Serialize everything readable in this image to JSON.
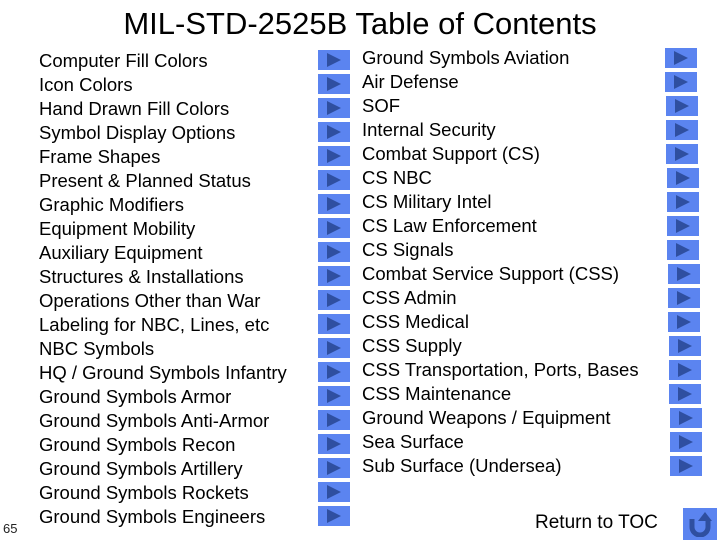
{
  "title": "MIL-STD-2525B Table of Contents",
  "page_number": "65",
  "colors": {
    "button_fill": "#5b84f0",
    "button_glyph": "#2f4fa0"
  },
  "left_items": [
    {
      "label": "Computer Fill Colors",
      "icon": "play-arrow-icon"
    },
    {
      "label": "Icon Colors",
      "icon": "play-arrow-icon"
    },
    {
      "label": "Hand Drawn Fill Colors",
      "icon": "play-arrow-icon"
    },
    {
      "label": "Symbol Display Options",
      "icon": "play-arrow-icon"
    },
    {
      "label": "Frame Shapes",
      "icon": "play-arrow-icon"
    },
    {
      "label": "Present & Planned Status",
      "icon": "play-arrow-icon"
    },
    {
      "label": "Graphic Modifiers",
      "icon": "play-arrow-icon"
    },
    {
      "label": "Equipment Mobility",
      "icon": "play-arrow-icon"
    },
    {
      "label": "Auxiliary Equipment",
      "icon": "play-arrow-icon"
    },
    {
      "label": "Structures & Installations",
      "icon": "play-arrow-icon"
    },
    {
      "label": "Operations Other than War",
      "icon": "play-arrow-icon"
    },
    {
      "label": "Labeling for NBC, Lines, etc",
      "icon": "play-arrow-icon"
    },
    {
      "label": "NBC Symbols",
      "icon": "play-arrow-icon"
    },
    {
      "label": "HQ / Ground Symbols Infantry",
      "icon": "play-arrow-icon"
    },
    {
      "label": "Ground Symbols Armor",
      "icon": "play-arrow-icon"
    },
    {
      "label": "Ground Symbols Anti-Armor",
      "icon": "play-arrow-icon"
    },
    {
      "label": "Ground Symbols Recon",
      "icon": "play-arrow-icon"
    },
    {
      "label": "Ground Symbols Artillery",
      "icon": "play-arrow-icon"
    },
    {
      "label": "Ground Symbols Rockets",
      "icon": "play-arrow-icon"
    },
    {
      "label": "Ground Symbols Engineers",
      "icon": "play-arrow-icon"
    }
  ],
  "right_items": [
    {
      "label": "Ground Symbols Aviation",
      "icon": "play-arrow-icon"
    },
    {
      "label": "Air Defense",
      "icon": "play-arrow-icon"
    },
    {
      "label": "SOF",
      "icon": "play-arrow-icon"
    },
    {
      "label": "Internal Security",
      "icon": "play-arrow-icon"
    },
    {
      "label": "Combat Support (CS)",
      "icon": "play-arrow-icon"
    },
    {
      "label": "CS NBC",
      "icon": "play-arrow-icon"
    },
    {
      "label": "CS Military Intel",
      "icon": "play-arrow-icon"
    },
    {
      "label": "CS Law Enforcement",
      "icon": "play-arrow-icon"
    },
    {
      "label": "CS Signals",
      "icon": "play-arrow-icon"
    },
    {
      "label": "Combat Service Support (CSS)",
      "icon": "play-arrow-icon"
    },
    {
      "label": "CSS Admin",
      "icon": "play-arrow-icon"
    },
    {
      "label": "CSS Medical",
      "icon": "play-arrow-icon"
    },
    {
      "label": "CSS Supply",
      "icon": "play-arrow-icon"
    },
    {
      "label": "CSS Transportation, Ports, Bases",
      "icon": "play-arrow-icon"
    },
    {
      "label": "CSS Maintenance",
      "icon": "play-arrow-icon"
    },
    {
      "label": "Ground Weapons / Equipment",
      "icon": "play-arrow-icon"
    },
    {
      "label": "Sea Surface",
      "icon": "play-arrow-icon"
    },
    {
      "label": "Sub Surface (Undersea)",
      "icon": "play-arrow-icon"
    }
  ],
  "return": {
    "label": "Return to TOC",
    "icon": "return-arrow-icon"
  }
}
